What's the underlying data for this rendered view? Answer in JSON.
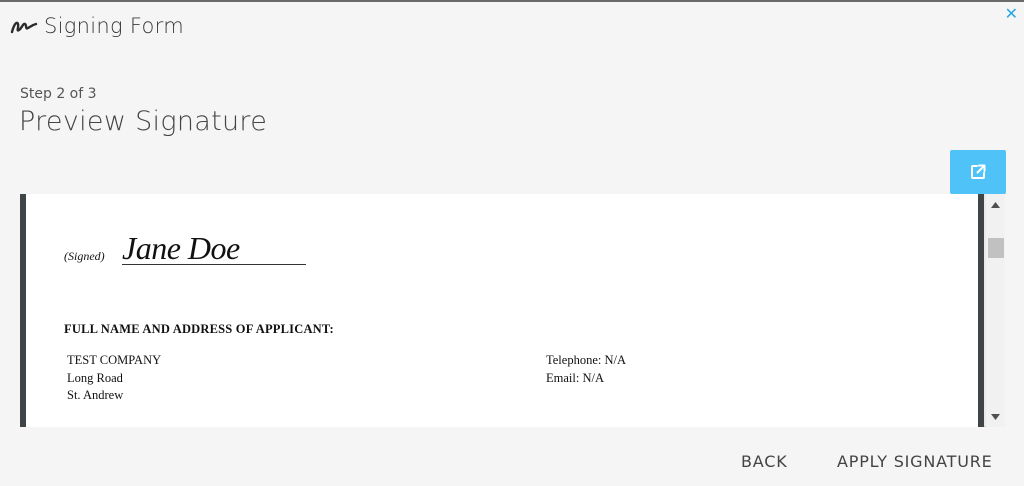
{
  "app": {
    "title": "Signing Form",
    "close_glyph": "✕",
    "accent_color": "#2aa7e0",
    "logo_icon": "signature-logo-icon"
  },
  "step": {
    "label": "Step 2 of 3",
    "title": "Preview Signature"
  },
  "toolbar": {
    "open_external_icon": "open-in-new-icon",
    "button_color": "#4fc3f7"
  },
  "document": {
    "signed_label": "(Signed)",
    "signature_text": "Jane Doe",
    "section_heading": "FULL NAME AND ADDRESS OF APPLICANT:",
    "address_lines": [
      "TEST COMPANY",
      "Long Road",
      "St. Andrew"
    ],
    "contact_lines": [
      "Telephone: N/A",
      "Email: N/A"
    ]
  },
  "footer": {
    "back_label": "BACK",
    "apply_label": "APPLY SIGNATURE"
  }
}
